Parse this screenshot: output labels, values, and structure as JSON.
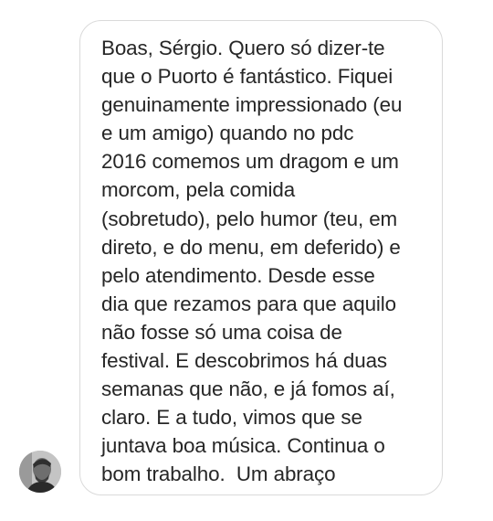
{
  "message": {
    "lines": [
      "Boas, Sérgio. Quero só dizer-te",
      "que o Puorto é fantástico. Fiquei",
      "genuinamente impressionado (eu",
      "e um amigo) quando no pdc",
      "2016 comemos um dragom e um",
      "morcom, pela comida",
      "(sobretudo), pelo humor (teu, em",
      "direto, e do menu, em deferido) e",
      "pelo atendimento. Desde esse",
      "dia que rezamos para que aquilo",
      "não fosse só uma coisa de",
      "festival. E descobrimos há duas",
      "semanas que não, e já fomos aí,",
      "claro. E a tudo, vimos que se",
      "juntava boa música. Continua o",
      "bom trabalho.  Um abraço"
    ]
  },
  "colors": {
    "text": "#262626",
    "bubble_border": "#dadada",
    "background": "#ffffff"
  },
  "icons": {
    "avatar": "sender-avatar-photo"
  }
}
